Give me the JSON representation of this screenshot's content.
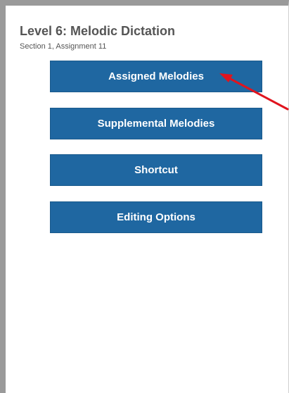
{
  "header": {
    "title": "Level 6: Melodic Dictation",
    "subtitle": "Section 1, Assignment 11"
  },
  "menu": {
    "items": [
      {
        "label": "Assigned Melodies"
      },
      {
        "label": "Supplemental Melodies"
      },
      {
        "label": "Shortcut"
      },
      {
        "label": "Editing Options"
      }
    ]
  },
  "colors": {
    "button_background": "#1f67a1",
    "button_text": "#ffffff",
    "title_text": "#555555",
    "annotation_arrow": "#e0141e",
    "frame_border": "#9a9a9a"
  },
  "annotation": {
    "icon": "red-arrow-icon",
    "points_to": "Assigned Melodies"
  }
}
